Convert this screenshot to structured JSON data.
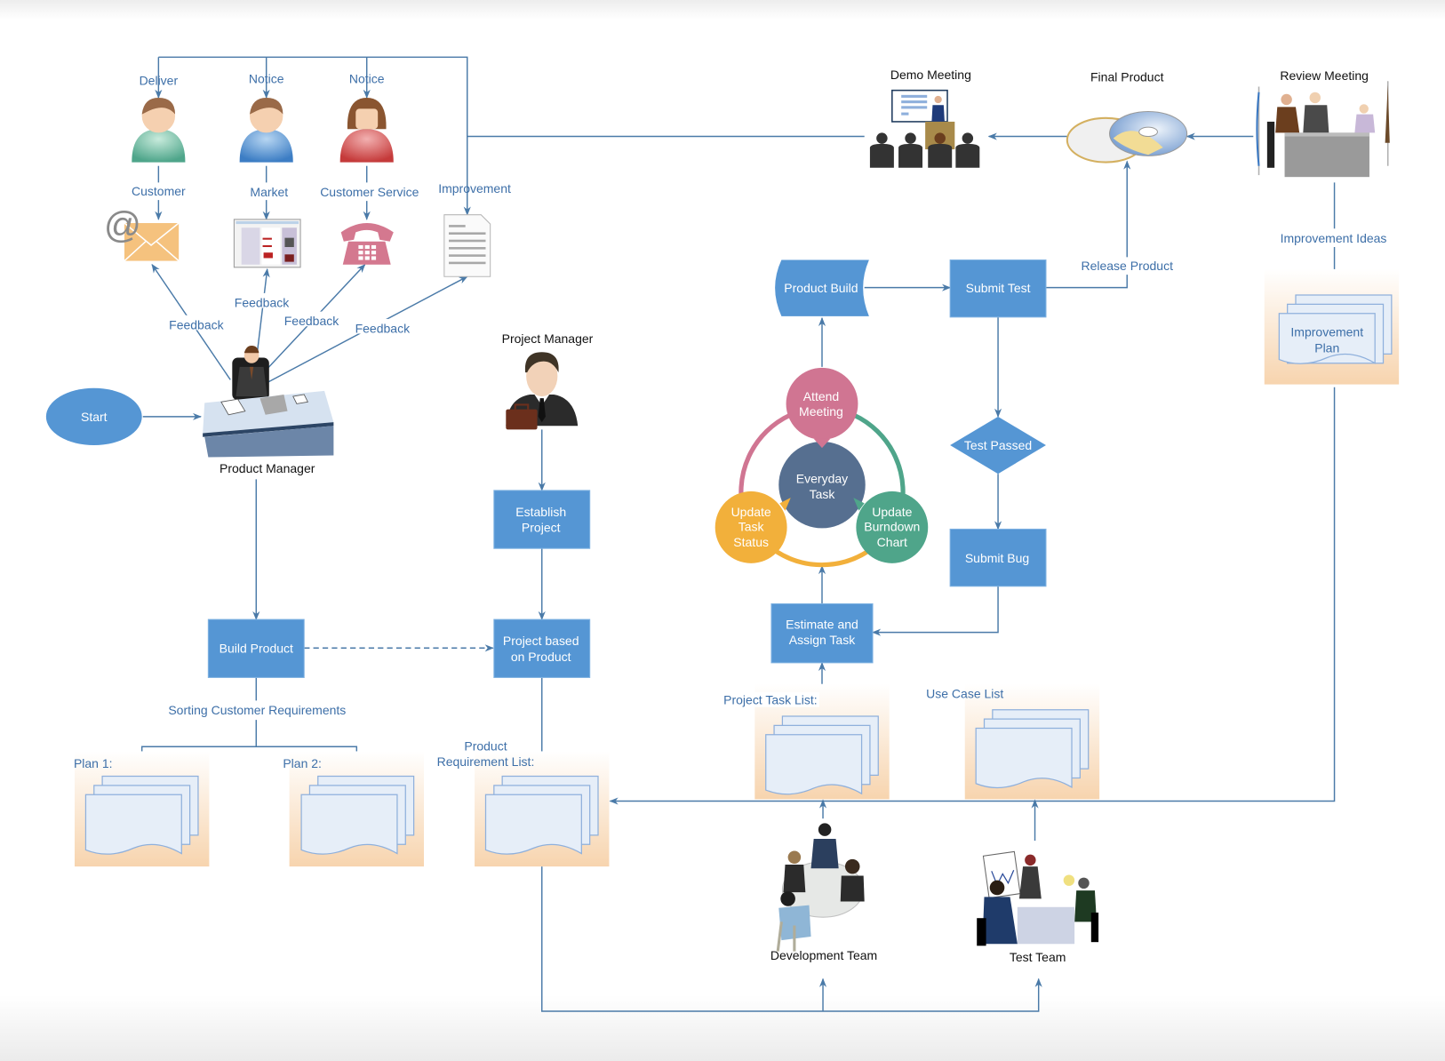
{
  "colors": {
    "box_fill": "#5596d4",
    "connector": "#4a7aa8",
    "label_text": "#3d6fa8",
    "attend_meeting": "#d07592",
    "everyday_task": "#566f90",
    "update_task_status": "#f2b03b",
    "update_burndown": "#4fa58a",
    "panel_gradient_bottom": "#f7d4ae"
  },
  "top_left": {
    "people": [
      {
        "top_label": "Deliver",
        "role": "Customer",
        "icon": "email-at-icon"
      },
      {
        "top_label": "Notice",
        "role": "Market",
        "icon": "webpage-icon"
      },
      {
        "top_label": "Notice",
        "role": "Customer Service",
        "icon": "telephone-icon"
      }
    ],
    "improvement_label": "Improvement",
    "feedback_labels": [
      "Feedback",
      "Feedback",
      "Feedback",
      "Feedback"
    ]
  },
  "start": {
    "label": "Start"
  },
  "product_manager": {
    "label": "Product Manager"
  },
  "project_manager": {
    "label": "Project Manager"
  },
  "boxes": {
    "build_product": "Build Product",
    "establish_project": [
      "Establish",
      "Project"
    ],
    "project_based": [
      "Project based",
      "on Product"
    ],
    "product_build": "Product Build",
    "submit_test": "Submit Test",
    "test_passed": "Test Passed",
    "submit_bug": "Submit Bug",
    "estimate_assign": [
      "Estimate and",
      "Assign Task"
    ]
  },
  "cycle": {
    "attend_meeting": [
      "Attend",
      "Meeting"
    ],
    "everyday_task": [
      "Everyday",
      "Task"
    ],
    "update_task_status": [
      "Update",
      "Task",
      "Status"
    ],
    "update_burndown": [
      "Update",
      "Burndown",
      "Chart"
    ]
  },
  "labels": {
    "sorting": "Sorting Customer Requirements",
    "plan1": "Plan 1:",
    "plan2": "Plan 2:",
    "product_req": [
      "Product",
      "Requirement List:"
    ],
    "project_task_list": "Project Task List:",
    "use_case_list": "Use Case List",
    "release_product": "Release Product",
    "improvement_ideas": "Improvement Ideas",
    "improvement_plan": [
      "Improvement",
      "Plan"
    ]
  },
  "top_right": {
    "demo_meeting": "Demo Meeting",
    "final_product": "Final Product",
    "review_meeting": "Review Meeting"
  },
  "teams": {
    "development": "Development Team",
    "test": "Test Team"
  }
}
